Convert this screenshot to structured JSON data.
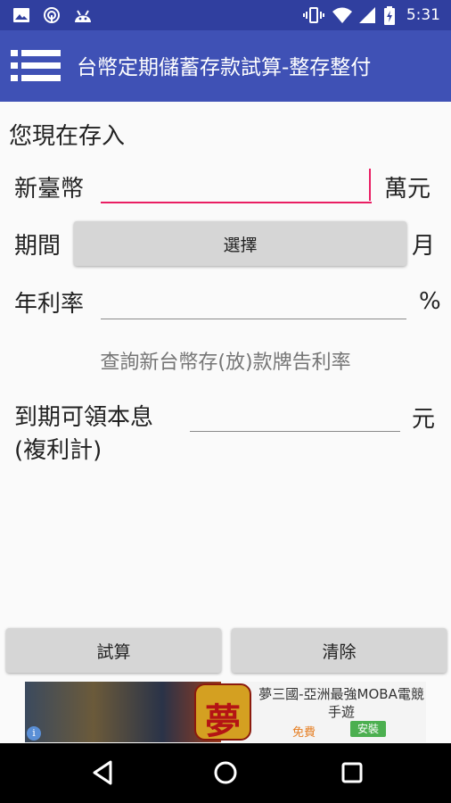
{
  "status_bar": {
    "time": "5:31",
    "left_icons": [
      "image-icon",
      "target-icon",
      "android-icon"
    ],
    "right_icons": [
      "vibrate-icon",
      "wifi-icon",
      "signal-icon",
      "battery-icon"
    ]
  },
  "app_bar": {
    "title": "台幣定期儲蓄存款試算-整存整付",
    "menu_icon": "hamburger-menu-icon"
  },
  "form": {
    "heading": "您現在存入",
    "amount": {
      "label": "新臺幣",
      "value": "",
      "unit": "萬元"
    },
    "period": {
      "label": "期間",
      "button": "選擇",
      "unit": "月"
    },
    "rate": {
      "label": "年利率",
      "value": "",
      "unit": "%"
    },
    "rate_link": "查詢新台幣存(放)款牌告利率",
    "result": {
      "label_line1": "到期可領本息",
      "label_line2": "(複利計)",
      "value": "",
      "unit": "元"
    }
  },
  "buttons": {
    "calculate": "試算",
    "clear": "清除"
  },
  "ad": {
    "title": "夢三國-亞洲最強MOBA電競手遊",
    "free_label": "免費",
    "install_label": "安裝",
    "logo_text": "夢"
  },
  "colors": {
    "status_bar": "#303f9f",
    "app_bar": "#3f51b5",
    "accent": "#e91e63",
    "button": "#d6d6d6"
  },
  "nav_bar": {
    "icons": [
      "back-icon",
      "home-icon",
      "recents-icon"
    ]
  }
}
